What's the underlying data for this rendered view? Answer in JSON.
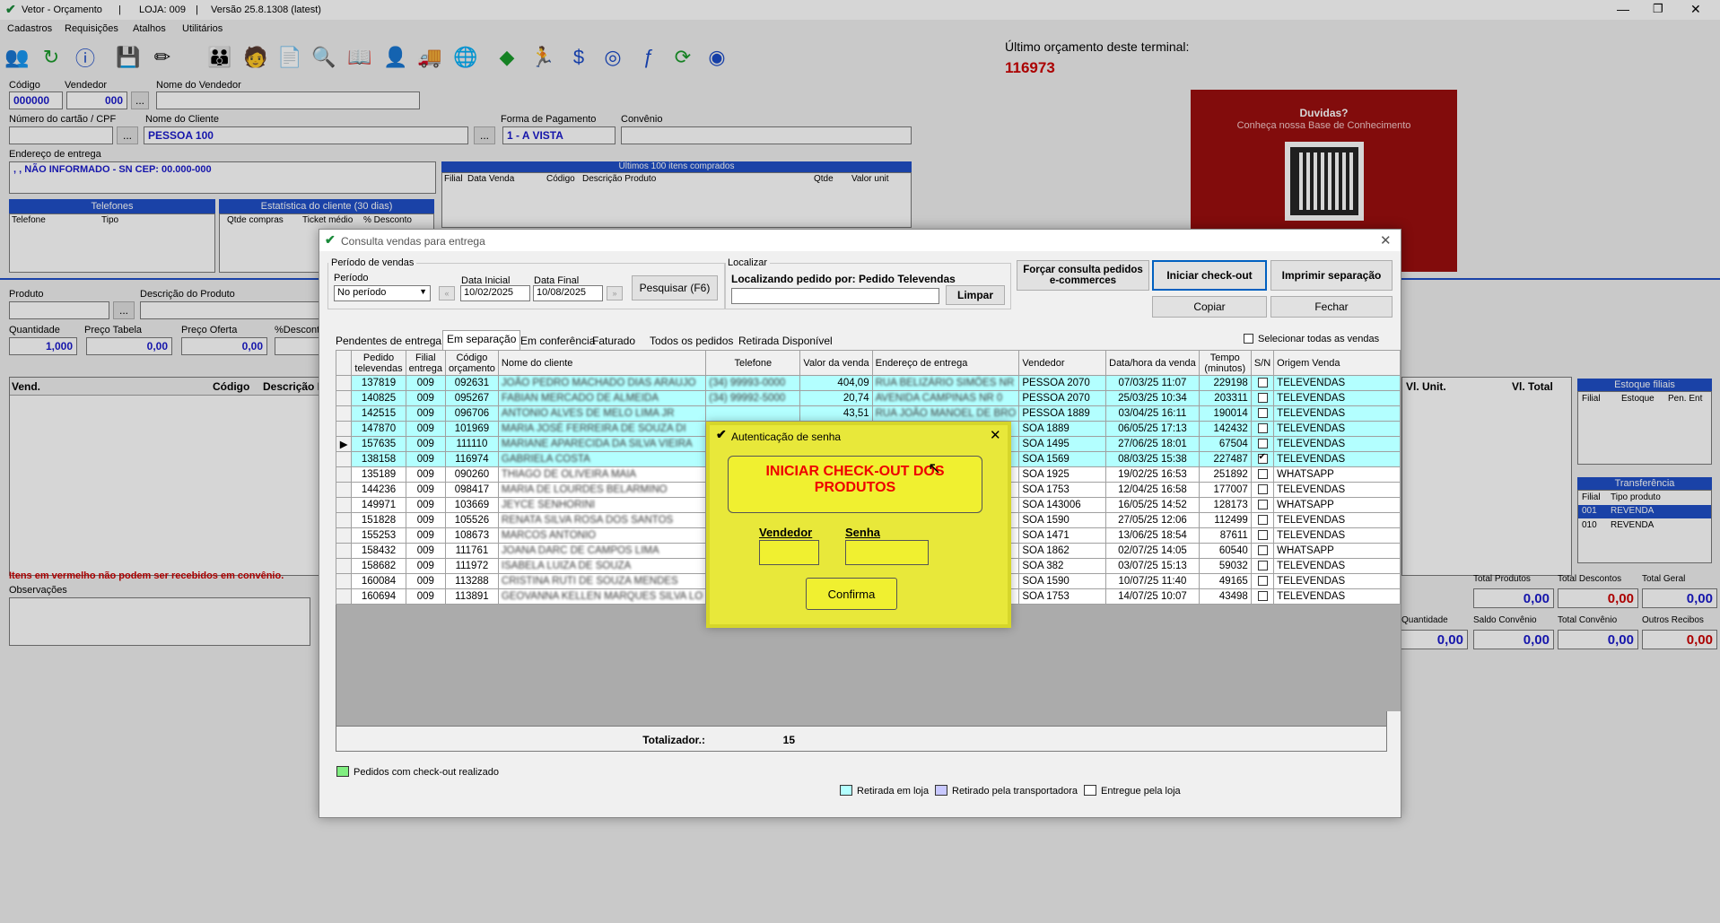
{
  "app": {
    "title": "Vetor - Orçamento",
    "loja": "LOJA: 009",
    "versao": "Versão 25.8.1308 (latest)",
    "menu": [
      "Cadastros",
      "Requisições",
      "Atalhos",
      "Utilitários"
    ]
  },
  "last_quote": {
    "label": "Último orçamento deste terminal:",
    "value": "116973"
  },
  "promo": {
    "title": "Duvidas?",
    "subtitle": "Conheça nossa Base de Conhecimento"
  },
  "form": {
    "codigo_label": "Código",
    "codigo": "000000",
    "vendedor_label": "Vendedor",
    "vendedor": "000",
    "nome_vendedor_label": "Nome do Vendedor",
    "cartao_label": "Número do cartão / CPF",
    "nome_cliente_label": "Nome do Cliente",
    "nome_cliente": "PESSOA 100",
    "pagamento_label": "Forma de Pagamento",
    "pagamento": "1 - A VISTA",
    "convenio_label": "Convênio",
    "endereco_label": "Endereço de entrega",
    "endereco": ", , NÃO INFORMADO - SN CEP: 00.000-000",
    "ultimos_itens": "Últimos 100 itens comprados",
    "ultimos_cols": [
      "Filial",
      "Data Venda",
      "Código",
      "Descrição Produto",
      "Qtde",
      "Valor unit"
    ],
    "telefones": "Telefones",
    "tel_cols": [
      "Telefone",
      "Tipo"
    ],
    "estatistica": "Estatística do cliente (30 dias)",
    "est_cols": [
      "Qtde compras",
      "Ticket médio",
      "% Desconto"
    ],
    "produto_label": "Produto",
    "desc_produto_label": "Descrição do Produto",
    "quantidade_label": "Quantidade",
    "quantidade": "1,000",
    "preco_tabela_label": "Preço Tabela",
    "preco_tabela": "0,00",
    "preco_oferta_label": "Preço Oferta",
    "preco_oferta": "0,00",
    "desconto_label": "%Desconto",
    "itens_cols": [
      "Vend.",
      "Código",
      "Descrição I"
    ],
    "aviso": "Itens em vermelho não podem ser recebidos em convênio.",
    "obs_label": "Observações",
    "vl_unit": "Vl. Unit.",
    "vl_total": "Vl. Total",
    "estoque_filiais": "Estoque filiais",
    "estoque_cols": [
      "Filial",
      "Estoque",
      "Pen. Ent"
    ],
    "transferencia": "Transferência",
    "transf_cols": [
      "Filial",
      "Tipo produto"
    ],
    "transf_rows": [
      [
        "001",
        "REVENDA"
      ],
      [
        "010",
        "REVENDA"
      ]
    ],
    "totais": [
      {
        "label": "Total Produtos",
        "value": "0,00"
      },
      {
        "label": "Total Descontos",
        "value": "0,00"
      },
      {
        "label": "Total Geral",
        "value": "0,00"
      }
    ],
    "totais2": [
      {
        "label": "Quantidade",
        "value": "0,00"
      },
      {
        "label": "Saldo Convênio",
        "value": "0,00"
      },
      {
        "label": "Total Convênio",
        "value": "0,00"
      },
      {
        "label": "Outros Recibos",
        "value": "0,00"
      }
    ]
  },
  "modal": {
    "title": "Consulta vendas para entrega",
    "periodo_legend": "Período de vendas",
    "periodo_label": "Período",
    "periodo": "No período",
    "data_inicial_label": "Data Inicial",
    "data_inicial": "10/02/2025",
    "data_final_label": "Data Final",
    "data_final": "10/08/2025",
    "pesquisar": "Pesquisar (F6)",
    "localizar_legend": "Localizar",
    "localizando": "Localizando pedido por: Pedido Televendas",
    "limpar": "Limpar",
    "forcar": "Forçar consulta pedidos e-commerces",
    "iniciar": "Iniciar check-out",
    "imprimir": "Imprimir separação",
    "copiar": "Copiar",
    "fechar": "Fechar",
    "selecionar_todas": "Selecionar todas as vendas",
    "tabs": [
      "Pendentes de entrega",
      "Em separação",
      "Em conferência",
      "Faturado",
      "Todos os pedidos",
      "Retirada Disponível"
    ],
    "columns": [
      "Pedido televendas",
      "Filial entrega",
      "Código orçamento",
      "Nome do cliente",
      "Telefone",
      "Valor da venda",
      "Endereço de entrega",
      "Vendedor",
      "Data/hora da venda",
      "Tempo (minutos)",
      "S/N",
      "Origem Venda"
    ],
    "rows": [
      {
        "pedido": "137819",
        "filial": "009",
        "codigo": "092631",
        "cliente": "JOÃO PEDRO MACHADO DIAS ARAUJO",
        "telefone": "(34) 99993-0000",
        "valor": "404,09",
        "endereco": "RUA BELIZÁRIO SIMÕES NR",
        "vendedor": "PESSOA 2070",
        "data": "07/03/25 11:07",
        "tempo": "229198",
        "sn": false,
        "origem": "TELEVENDAS",
        "hl": true
      },
      {
        "pedido": "140825",
        "filial": "009",
        "codigo": "095267",
        "cliente": "FABIAN MERCADO DE ALMEIDA",
        "telefone": "(34) 99992-5000",
        "valor": "20,74",
        "endereco": "AVENIDA CAMPINAS NR 0",
        "vendedor": "PESSOA 2070",
        "data": "25/03/25 10:34",
        "tempo": "203311",
        "sn": false,
        "origem": "TELEVENDAS",
        "hl": true
      },
      {
        "pedido": "142515",
        "filial": "009",
        "codigo": "096706",
        "cliente": "ANTONIO ALVES DE MELO LIMA JR",
        "telefone": "",
        "valor": "43,51",
        "endereco": "RUA JOÃO MANOEL DE BRO",
        "vendedor": "PESSOA 1889",
        "data": "03/04/25 16:11",
        "tempo": "190014",
        "sn": false,
        "origem": "TELEVENDAS",
        "hl": true
      },
      {
        "pedido": "147870",
        "filial": "009",
        "codigo": "101969",
        "cliente": "MARIA JOSÉ FERREIRA DE SOUZA DI",
        "telefone": "",
        "valor": "",
        "endereco": "",
        "vendedor": "SOA 1889",
        "data": "06/05/25 17:13",
        "tempo": "142432",
        "sn": false,
        "origem": "TELEVENDAS",
        "hl": true
      },
      {
        "pedido": "157635",
        "filial": "009",
        "codigo": "111110",
        "cliente": "MARIANE APARECIDA DA SILVA VIEIRA",
        "telefone": "",
        "valor": "",
        "endereco": "",
        "vendedor": "SOA 1495",
        "data": "27/06/25 18:01",
        "tempo": "67504",
        "sn": false,
        "origem": "TELEVENDAS",
        "hl": true,
        "cur": true
      },
      {
        "pedido": "138158",
        "filial": "009",
        "codigo": "116974",
        "cliente": "GABRIELA COSTA",
        "telefone": "",
        "valor": "",
        "endereco": "",
        "vendedor": "SOA 1569",
        "data": "08/03/25 15:38",
        "tempo": "227487",
        "sn": true,
        "origem": "TELEVENDAS",
        "hl": true
      },
      {
        "pedido": "135189",
        "filial": "009",
        "codigo": "090260",
        "cliente": "THIAGO DE OLIVEIRA MAIA",
        "telefone": "",
        "valor": "",
        "endereco": "",
        "vendedor": "SOA 1925",
        "data": "19/02/25 16:53",
        "tempo": "251892",
        "sn": false,
        "origem": "WHATSAPP",
        "hl": false
      },
      {
        "pedido": "144236",
        "filial": "009",
        "codigo": "098417",
        "cliente": "MARIA DE LOURDES BELARMINO",
        "telefone": "",
        "valor": "",
        "endereco": "",
        "vendedor": "SOA 1753",
        "data": "12/04/25 16:58",
        "tempo": "177007",
        "sn": false,
        "origem": "TELEVENDAS",
        "hl": false
      },
      {
        "pedido": "149971",
        "filial": "009",
        "codigo": "103669",
        "cliente": "JEYCE SENHORINI",
        "telefone": "",
        "valor": "",
        "endereco": "",
        "vendedor": "SOA 143006",
        "data": "16/05/25 14:52",
        "tempo": "128173",
        "sn": false,
        "origem": "WHATSAPP",
        "hl": false
      },
      {
        "pedido": "151828",
        "filial": "009",
        "codigo": "105526",
        "cliente": "RENATA SILVA ROSA DOS SANTOS",
        "telefone": "",
        "valor": "",
        "endereco": "",
        "vendedor": "SOA 1590",
        "data": "27/05/25 12:06",
        "tempo": "112499",
        "sn": false,
        "origem": "TELEVENDAS",
        "hl": false
      },
      {
        "pedido": "155253",
        "filial": "009",
        "codigo": "108673",
        "cliente": "MARCOS ANTONIO",
        "telefone": "",
        "valor": "",
        "endereco": "",
        "vendedor": "SOA 1471",
        "data": "13/06/25 18:54",
        "tempo": "87611",
        "sn": false,
        "origem": "TELEVENDAS",
        "hl": false
      },
      {
        "pedido": "158432",
        "filial": "009",
        "codigo": "111761",
        "cliente": "JOANA DARC DE CAMPOS LIMA",
        "telefone": "",
        "valor": "",
        "endereco": "",
        "vendedor": "SOA 1862",
        "data": "02/07/25 14:05",
        "tempo": "60540",
        "sn": false,
        "origem": "WHATSAPP",
        "hl": false
      },
      {
        "pedido": "158682",
        "filial": "009",
        "codigo": "111972",
        "cliente": "ISABELA LUIZA DE SOUZA",
        "telefone": "",
        "valor": "",
        "endereco": "",
        "vendedor": "SOA 382",
        "data": "03/07/25 15:13",
        "tempo": "59032",
        "sn": false,
        "origem": "TELEVENDAS",
        "hl": false
      },
      {
        "pedido": "160084",
        "filial": "009",
        "codigo": "113288",
        "cliente": "CRISTINA RUTI DE SOUZA MENDES",
        "telefone": "",
        "valor": "",
        "endereco": "",
        "vendedor": "SOA 1590",
        "data": "10/07/25 11:40",
        "tempo": "49165",
        "sn": false,
        "origem": "TELEVENDAS",
        "hl": false
      },
      {
        "pedido": "160694",
        "filial": "009",
        "codigo": "113891",
        "cliente": "GEOVANNA KELLEN MARQUES SILVA LO",
        "telefone": "",
        "valor": "",
        "endereco": "",
        "vendedor": "SOA 1753",
        "data": "14/07/25 10:07",
        "tempo": "43498",
        "sn": false,
        "origem": "TELEVENDAS",
        "hl": false
      }
    ],
    "totalizador_label": "Totalizador.:",
    "totalizador": "15",
    "legend_checkout": "Pedidos com check-out realizado",
    "legend_retirada": "Retirada em loja",
    "legend_transportadora": "Retirado pela transportadora",
    "legend_entregue": "Entregue pela loja",
    "colors": {
      "retirada": "#b3ffff",
      "transportadora": "#c8c8ff",
      "checkout": "#80ee80"
    }
  },
  "auth": {
    "title": "Autenticação de senha",
    "heading": "INICIAR CHECK-OUT DOS PRODUTOS",
    "vendedor_label": "Vendedor",
    "senha_label": "Senha",
    "confirma": "Confirma"
  }
}
